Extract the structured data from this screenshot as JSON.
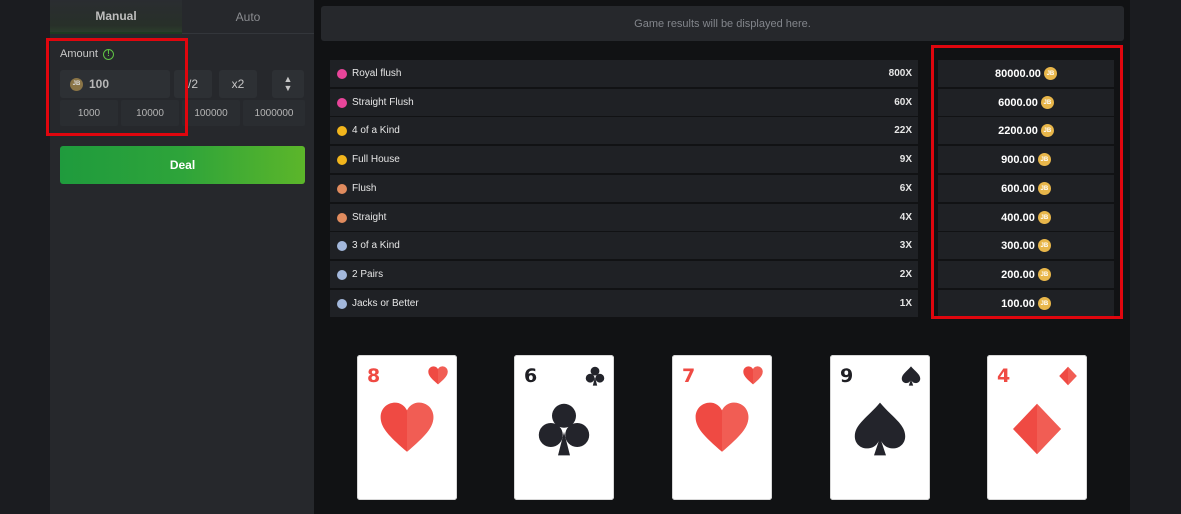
{
  "tabs": {
    "manual": "Manual",
    "auto": "Auto"
  },
  "amount": {
    "label": "Amount",
    "info": "!",
    "coin": "JB",
    "value": "100",
    "half": "/2",
    "double": "x2",
    "up": "▲",
    "down": "▼",
    "quick": [
      "1000",
      "10000",
      "100000",
      "1000000"
    ]
  },
  "deal_label": "Deal",
  "results_placeholder": "Game results will be displayed here.",
  "paytable": [
    {
      "hand": "Royal flush",
      "multiplier": "800X",
      "payout": "80000.00",
      "color": "#e8459a"
    },
    {
      "hand": "Straight Flush",
      "multiplier": "60X",
      "payout": "6000.00",
      "color": "#e8459a"
    },
    {
      "hand": "4 of a Kind",
      "multiplier": "22X",
      "payout": "2200.00",
      "color": "#f2b51c"
    },
    {
      "hand": "Full House",
      "multiplier": "9X",
      "payout": "900.00",
      "color": "#f2b51c"
    },
    {
      "hand": "Flush",
      "multiplier": "6X",
      "payout": "600.00",
      "color": "#e08b5e"
    },
    {
      "hand": "Straight",
      "multiplier": "4X",
      "payout": "400.00",
      "color": "#e08b5e"
    },
    {
      "hand": "3 of a Kind",
      "multiplier": "3X",
      "payout": "300.00",
      "color": "#a3b8dc"
    },
    {
      "hand": "2 Pairs",
      "multiplier": "2X",
      "payout": "200.00",
      "color": "#a3b8dc"
    },
    {
      "hand": "Jacks or Better",
      "multiplier": "1X",
      "payout": "100.00",
      "color": "#a3b8dc"
    }
  ],
  "payout_coin": "JB",
  "cards": [
    {
      "rank": "8",
      "suit": "hearts",
      "color": "red"
    },
    {
      "rank": "6",
      "suit": "clubs",
      "color": "black"
    },
    {
      "rank": "7",
      "suit": "hearts",
      "color": "red"
    },
    {
      "rank": "9",
      "suit": "spades",
      "color": "black"
    },
    {
      "rank": "4",
      "suit": "diamonds",
      "color": "red"
    }
  ],
  "colors": {
    "accent_green": "#2ea43a",
    "highlight_red": "#e0060e",
    "coin_gold": "#e8b64a"
  }
}
